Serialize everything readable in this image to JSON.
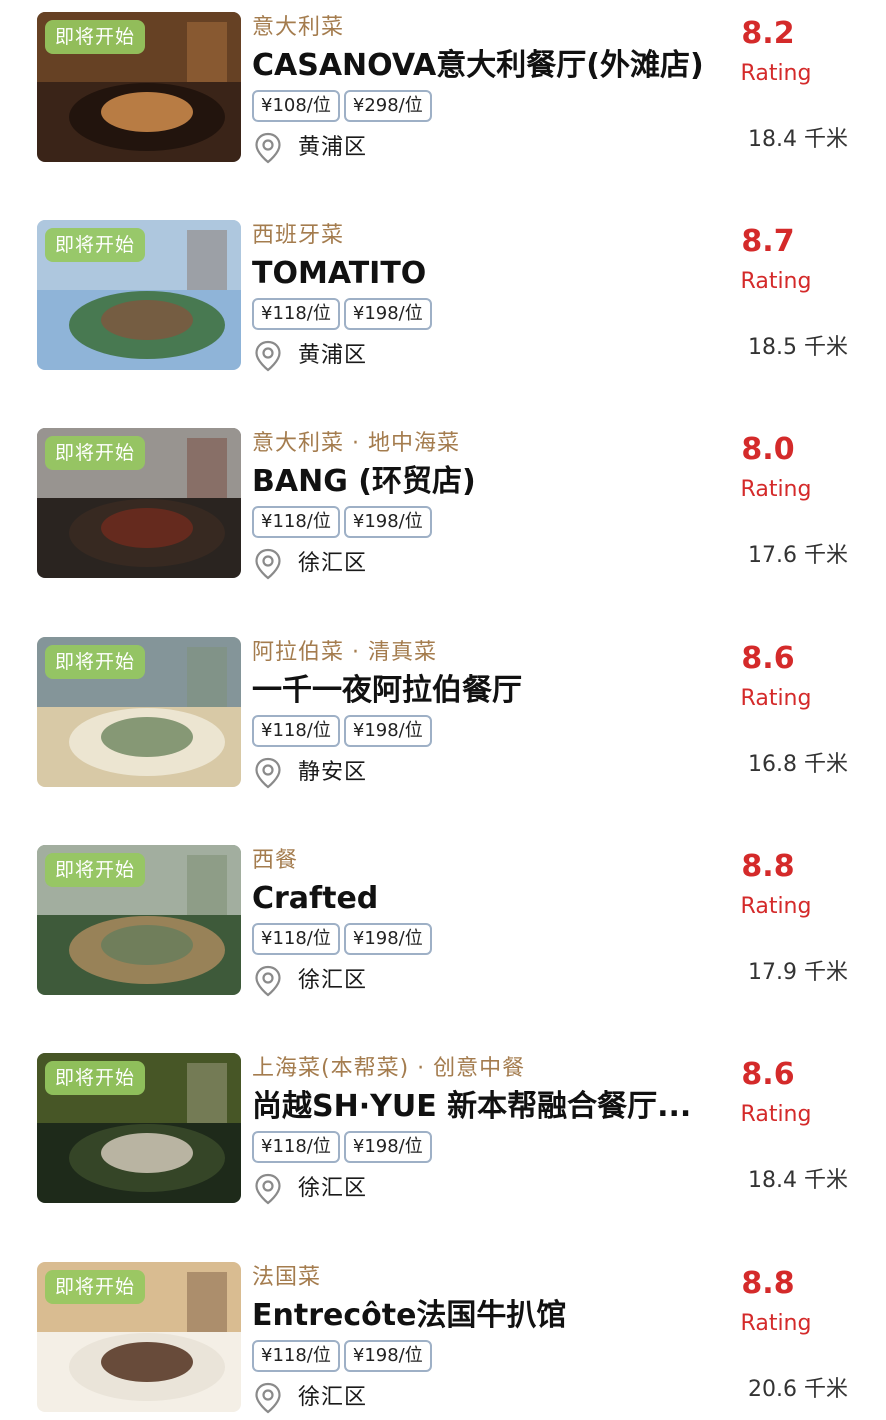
{
  "badge_label": "即将开始",
  "rating_label": "Rating",
  "colors": {
    "cuisine": "#a47c4e",
    "score": "#d42a2a",
    "badge": "#96c85f",
    "price_border": "#9eb0c6"
  },
  "restaurants": [
    {
      "cuisine": "意大利菜",
      "name": "CASANOVA意大利餐厅(外滩店)",
      "prices": [
        "¥108/位",
        "¥298/位"
      ],
      "district": "黄浦区",
      "score": "8.2",
      "distance": "18.4 千米",
      "thumb_icon": "restaurant-interior-photo"
    },
    {
      "cuisine": "西班牙菜",
      "name": "TOMATITO",
      "prices": [
        "¥118/位",
        "¥198/位"
      ],
      "district": "黄浦区",
      "score": "8.7",
      "distance": "18.5 千米",
      "thumb_icon": "terrace-photo"
    },
    {
      "cuisine": "意大利菜 · 地中海菜",
      "name": "BANG (环贸店)",
      "prices": [
        "¥118/位",
        "¥198/位"
      ],
      "district": "徐汇区",
      "score": "8.0",
      "distance": "17.6 千米",
      "thumb_icon": "beef-wellington-photo"
    },
    {
      "cuisine": "阿拉伯菜 · 清真菜",
      "name": "一千一夜阿拉伯餐厅",
      "prices": [
        "¥118/位",
        "¥198/位"
      ],
      "district": "静安区",
      "score": "8.6",
      "distance": "16.8 千米",
      "thumb_icon": "arabic-dining-hall-photo"
    },
    {
      "cuisine": "西餐",
      "name": "Crafted",
      "prices": [
        "¥118/位",
        "¥198/位"
      ],
      "district": "徐汇区",
      "score": "8.8",
      "distance": "17.9 千米",
      "thumb_icon": "garden-dining-photo"
    },
    {
      "cuisine": "上海菜(本帮菜) · 创意中餐",
      "name": "尚越SH·YUE 新本帮融合餐厅...",
      "prices": [
        "¥118/位",
        "¥198/位"
      ],
      "district": "徐汇区",
      "score": "8.6",
      "distance": "18.4 千米",
      "thumb_icon": "dim-sum-platter-photo"
    },
    {
      "cuisine": "法国菜",
      "name": "Entrecôte法国牛扒馆",
      "prices": [
        "¥118/位",
        "¥198/位"
      ],
      "district": "徐汇区",
      "score": "8.8",
      "distance": "20.6 千米",
      "thumb_icon": "steak-frites-photo"
    }
  ]
}
